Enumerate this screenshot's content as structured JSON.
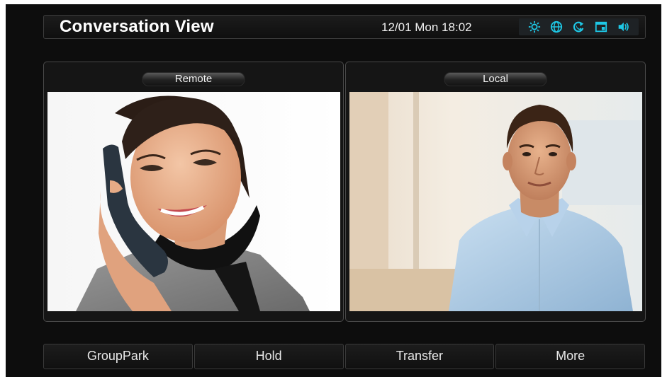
{
  "header": {
    "title": "Conversation View",
    "datetime": "12/01 Mon 18:02",
    "status_icons": [
      "brightness-icon",
      "network-globe-icon",
      "call-forward-icon",
      "voicemail-screen-icon",
      "volume-speaker-icon"
    ],
    "icon_color": "#1ec8e6"
  },
  "panels": {
    "remote": {
      "label": "Remote",
      "image": "woman-on-phone-video"
    },
    "local": {
      "label": "Local",
      "image": "man-in-blue-shirt-video"
    }
  },
  "softkeys": [
    "GroupPark",
    "Hold",
    "Transfer",
    "More"
  ]
}
